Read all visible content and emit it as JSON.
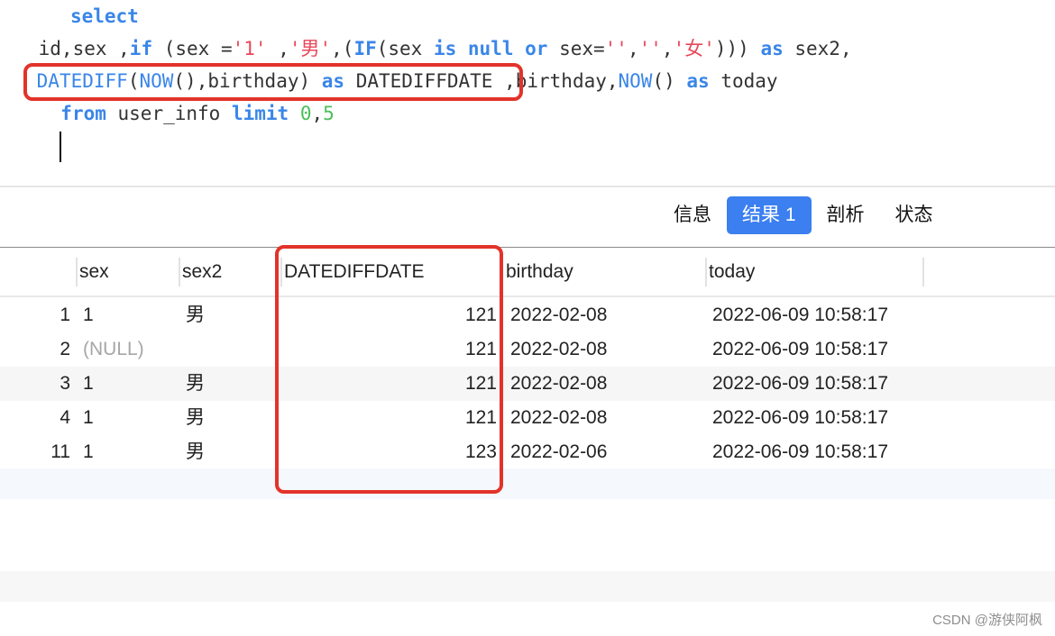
{
  "editor": {
    "lines": [
      [
        {
          "t": "   ",
          "c": ""
        },
        {
          "t": "select",
          "c": "kw"
        }
      ],
      [
        {
          "t": " id,sex ,",
          "c": ""
        },
        {
          "t": "if",
          "c": "kw"
        },
        {
          "t": " (sex =",
          "c": ""
        },
        {
          "t": "'1'",
          "c": "str"
        },
        {
          "t": " ,",
          "c": ""
        },
        {
          "t": "'男'",
          "c": "str"
        },
        {
          "t": ",(",
          "c": ""
        },
        {
          "t": "IF",
          "c": "kw"
        },
        {
          "t": "(sex ",
          "c": ""
        },
        {
          "t": "is",
          "c": "kw"
        },
        {
          "t": " ",
          "c": ""
        },
        {
          "t": "null",
          "c": "kw"
        },
        {
          "t": " ",
          "c": ""
        },
        {
          "t": "or",
          "c": "kw"
        },
        {
          "t": " sex=",
          "c": ""
        },
        {
          "t": "''",
          "c": "str"
        },
        {
          "t": ",",
          "c": ""
        },
        {
          "t": "''",
          "c": "str"
        },
        {
          "t": ",",
          "c": ""
        },
        {
          "t": "'女'",
          "c": "str"
        },
        {
          "t": "))) ",
          "c": ""
        },
        {
          "t": "as",
          "c": "kw"
        },
        {
          "t": " sex2,",
          "c": ""
        }
      ],
      [
        {
          "t": " ",
          "c": ""
        },
        {
          "t": "DATEDIFF",
          "c": "fn"
        },
        {
          "t": "(",
          "c": ""
        },
        {
          "t": "NOW",
          "c": "fn"
        },
        {
          "t": "(),birthday) ",
          "c": ""
        },
        {
          "t": "as",
          "c": "kw"
        },
        {
          "t": " DATEDIFFDATE ,birthday,",
          "c": ""
        },
        {
          "t": "NOW",
          "c": "fn"
        },
        {
          "t": "() ",
          "c": ""
        },
        {
          "t": "as",
          "c": "kw"
        },
        {
          "t": " today",
          "c": ""
        }
      ],
      [
        {
          "t": "  ",
          "c": ""
        },
        {
          "t": "from",
          "c": "kw"
        },
        {
          "t": " user_info ",
          "c": ""
        },
        {
          "t": "limit",
          "c": "kw"
        },
        {
          "t": " ",
          "c": ""
        },
        {
          "t": "0",
          "c": "num"
        },
        {
          "t": ",",
          "c": ""
        },
        {
          "t": "5",
          "c": "num"
        }
      ]
    ],
    "accent_color": "#3a86e8",
    "string_color": "#e8475a",
    "number_color": "#4cbf5a",
    "highlight_color": "#e2332a"
  },
  "tabs": [
    {
      "label": "信息",
      "active": false
    },
    {
      "label": "结果 1",
      "active": true
    },
    {
      "label": "剖析",
      "active": false
    },
    {
      "label": "状态",
      "active": false
    }
  ],
  "table": {
    "columns": [
      "",
      "sex",
      "sex2",
      "DATEDIFFDATE",
      "birthday",
      "today"
    ],
    "rows": [
      {
        "id": "1",
        "sex": "1",
        "sex2": "男",
        "datediffdate": "121",
        "birthday": "2022-02-08",
        "today": "2022-06-09 10:58:17"
      },
      {
        "id": "2",
        "sex": "(NULL)",
        "sex2": "",
        "datediffdate": "121",
        "birthday": "2022-02-08",
        "today": "2022-06-09 10:58:17"
      },
      {
        "id": "3",
        "sex": "1",
        "sex2": "男",
        "datediffdate": "121",
        "birthday": "2022-02-08",
        "today": "2022-06-09 10:58:17"
      },
      {
        "id": "4",
        "sex": "1",
        "sex2": "男",
        "datediffdate": "121",
        "birthday": "2022-02-08",
        "today": "2022-06-09 10:58:17"
      },
      {
        "id": "11",
        "sex": "1",
        "sex2": "男",
        "datediffdate": "123",
        "birthday": "2022-02-06",
        "today": "2022-06-09 10:58:17"
      }
    ]
  },
  "watermark": "CSDN @游侠阿枫"
}
